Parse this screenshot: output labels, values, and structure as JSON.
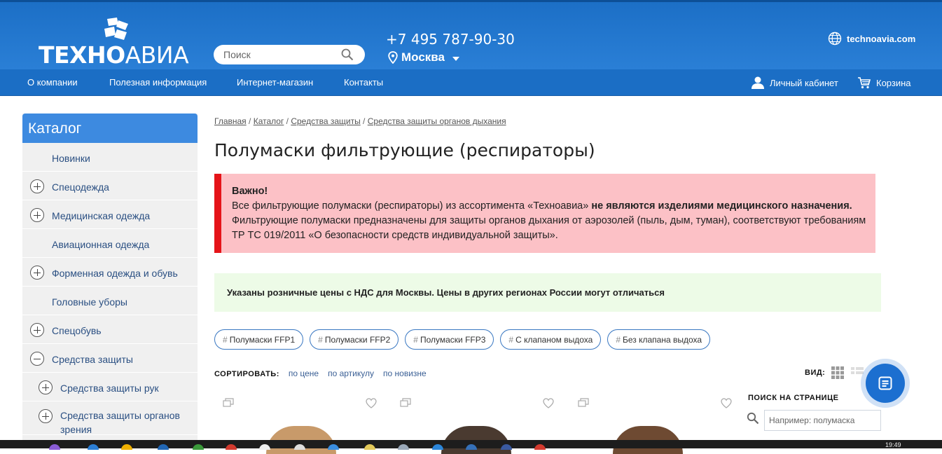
{
  "header": {
    "logo_text_bold": "ТЕХНО",
    "logo_text_light": "АВИА",
    "search_placeholder": "Поиск",
    "phone": "+7 495 787-90-30",
    "city": "Москва",
    "site": "technoavia.com"
  },
  "nav": {
    "items": [
      "О компании",
      "Полезная информация",
      "Интернет-магазин",
      "Контакты"
    ],
    "account": "Личный кабинет",
    "cart": "Корзина"
  },
  "catalog": {
    "title": "Каталог",
    "items": [
      {
        "label": "Новинки"
      },
      {
        "label": "Спецодежда"
      },
      {
        "label": "Медицинская одежда"
      },
      {
        "label": "Авиационная одежда"
      },
      {
        "label": "Форменная одежда и обувь"
      },
      {
        "label": "Головные уборы"
      },
      {
        "label": "Спецобувь"
      },
      {
        "label": "Средства защиты"
      },
      {
        "label": "Средства защиты рук"
      },
      {
        "label": "Средства защиты органов зрения"
      }
    ]
  },
  "breadcrumb": {
    "items": [
      "Главная",
      "Каталог",
      "Средства защиты",
      "Средства защиты органов дыхания"
    ],
    "separator": " / "
  },
  "page_title": "Полумаски фильтрующие (респираторы)",
  "notice": {
    "heading": "Важно!",
    "text_1": "Все фильтрующие полумаски (респираторы) из ассортимента «Техноавиа» ",
    "text_bold": "не являются изделиями медицинского назначения.",
    "text_2": " Фильтрующие полумаски предназначены для защиты органов дыхания от аэрозолей (пыль, дым, туман), соответствуют требованиям ТР ТС 019/2011 «О безопасности средств индивидуальной защиты».",
    "accent_color": "#e51419"
  },
  "price_note": "Указаны розничные цены с НДС для Москвы. Цены в других регионах России могут отличаться",
  "tags": [
    "Полумаски FFP1",
    "Полумаски FFP2",
    "Полумаски FFP3",
    "С клапаном выдоха",
    "Без клапана выдоха"
  ],
  "tag_hash": "#",
  "sort": {
    "label": "СОРТИРОВАТЬ:",
    "options": [
      "по цене",
      "по артикулу",
      "по новизне"
    ]
  },
  "view": {
    "label": "ВИД:"
  },
  "page_search": {
    "label": "ПОИСК НА СТРАНИЦЕ",
    "placeholder": "Например: полумаска"
  },
  "taskbar": {
    "clock": "19:49"
  },
  "colors": {
    "header_blue": "#1c6fc6",
    "catalog_head": "#3d8ae0",
    "notice_bg": "#fcc1c6",
    "price_note_bg": "#edfbe7",
    "chat_button": "#1c6fd0"
  }
}
